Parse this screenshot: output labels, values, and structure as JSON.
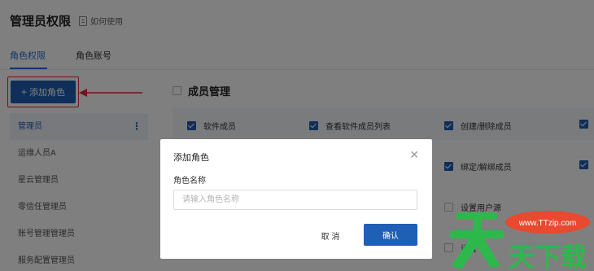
{
  "header": {
    "title": "管理员权限",
    "help_label": "如何使用"
  },
  "tabs": [
    {
      "label": "角色权限",
      "active": true
    },
    {
      "label": "角色账号",
      "active": false
    }
  ],
  "toolbar": {
    "add_role_label": "添加角色"
  },
  "sidebar": {
    "items": [
      {
        "label": "管理员",
        "active": true
      },
      {
        "label": "运维人员A"
      },
      {
        "label": "星云管理员"
      },
      {
        "label": "零信任管理员"
      },
      {
        "label": "账号管理管理员"
      },
      {
        "label": "服务配置管理员"
      }
    ]
  },
  "main": {
    "section_title": "成员管理",
    "permissions": [
      {
        "label": "软件成员",
        "checked": true
      },
      {
        "label": "查看软件成员列表",
        "checked": true
      },
      {
        "label": "创建/删除成员",
        "checked": true
      },
      {
        "label": "绑定/解绑成员",
        "checked": true
      },
      {
        "label": "设置用户源",
        "checked": false
      },
      {
        "label": "设置",
        "checked": false
      }
    ]
  },
  "dialog": {
    "title": "添加角色",
    "field_label": "角色名称",
    "field_placeholder": "请输入角色名称",
    "field_value": "",
    "cancel_label": "取 消",
    "confirm_label": "确认"
  },
  "watermark": {
    "main_text": "天下载",
    "badge_text": "www.TTzip.com"
  },
  "colors": {
    "primary": "#1f5fb5",
    "highlight": "#e5263b",
    "tab_active": "#1f6fd1",
    "watermark_green": "#2db84c",
    "watermark_red": "#e8492f"
  }
}
